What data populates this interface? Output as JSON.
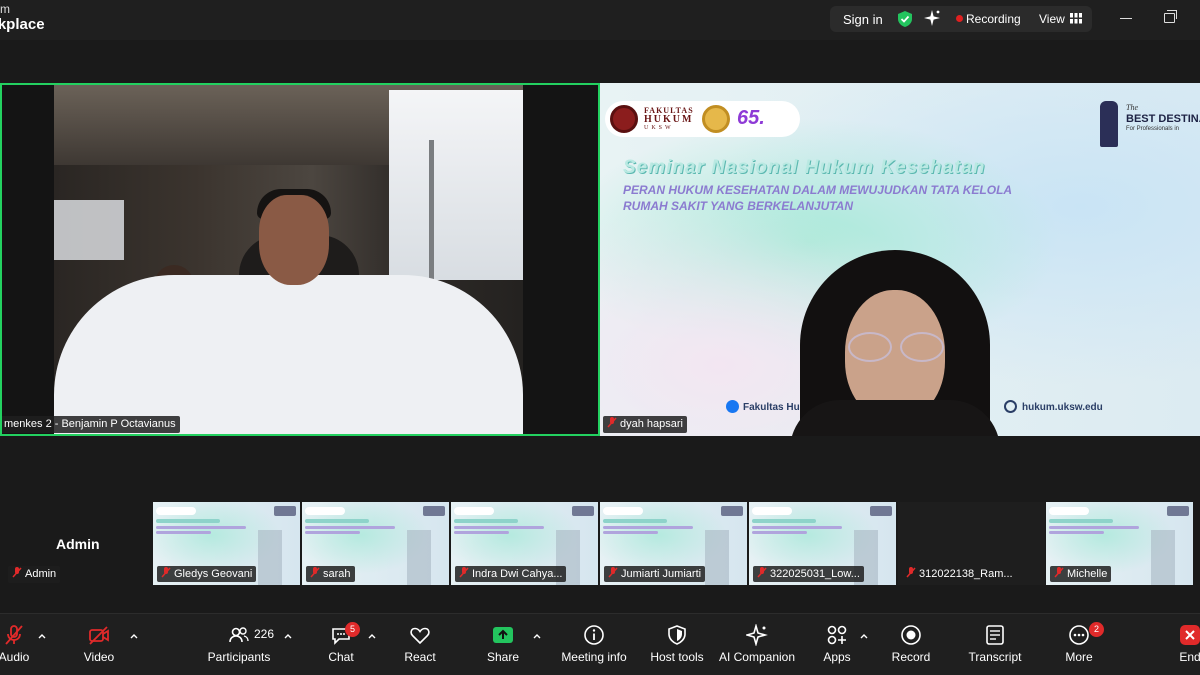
{
  "app": {
    "brand_line1": "m",
    "brand_line2": "rkplace"
  },
  "topbar": {
    "sign_in": "Sign in",
    "recording": "Recording",
    "view": "View",
    "recording_color": "#e02020",
    "shield_color": "#23c45e"
  },
  "main_tiles": {
    "left": {
      "name": "menkes 2 - Benjamin P Octavianus",
      "active_border": "#23d160"
    },
    "right": {
      "name": "dyah hapsari",
      "slide": {
        "logo_fakultas": "FAKULTAS",
        "logo_hukum": "HUKUM",
        "logo_uksw": "UKSW",
        "logo_number": "65.",
        "best_the": "The",
        "best_title": "BEST DESTINAT",
        "best_sub": "For Professionals in",
        "title": "Seminar Nasional Hukum Kesehatan",
        "subtitle_line1": "PERAN HUKUM KESEHATAN DALAM MEWUJUDKAN TATA KELOLA",
        "subtitle_line2": "RUMAH SAKIT YANG BERKELANJUTAN",
        "facebook": "Fakultas Hu",
        "website": "hukum.uksw.edu"
      }
    }
  },
  "filmstrip": {
    "self_big": "Admin",
    "self_chip": "Admin",
    "participants": [
      {
        "name": "Gledys Geovani",
        "screen": true
      },
      {
        "name": "sarah",
        "screen": true
      },
      {
        "name": "Indra Dwi Cahya...",
        "screen": true
      },
      {
        "name": "Jumiarti Jumiarti",
        "screen": true
      },
      {
        "name": "322025031_Low...",
        "screen": true
      },
      {
        "name": "312022138_Ram...",
        "screen": false
      },
      {
        "name": "Michelle",
        "screen": true
      }
    ]
  },
  "toolbar": {
    "audio": "Audio",
    "video": "Video",
    "participants": "Participants",
    "participants_count": "226",
    "chat": "Chat",
    "chat_badge": "5",
    "react": "React",
    "share": "Share",
    "meeting_info": "Meeting info",
    "host_tools": "Host tools",
    "ai_companion": "AI Companion",
    "apps": "Apps",
    "record": "Record",
    "transcript": "Transcript",
    "more": "More",
    "more_badge": "2",
    "end": "End",
    "share_color": "#23c45e",
    "mute_color": "#e02a2a"
  }
}
